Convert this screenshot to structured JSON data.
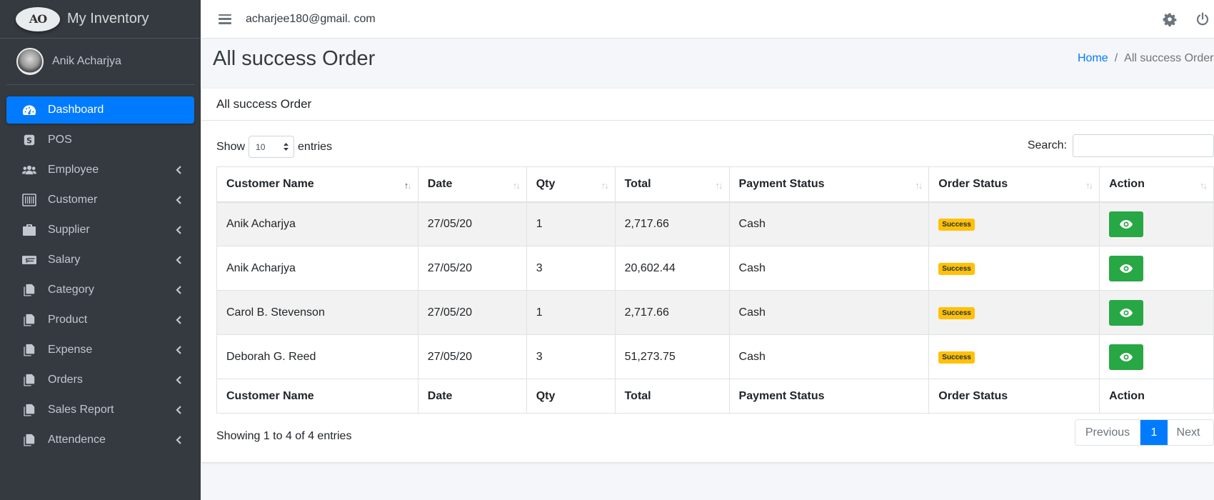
{
  "brand": {
    "logo_text": "AO",
    "name": "My Inventory"
  },
  "user": {
    "name": "Anik Acharjya"
  },
  "sidebar": {
    "items": [
      {
        "label": "Dashboard",
        "icon": "tachometer-icon",
        "active": true,
        "submenu": false
      },
      {
        "label": "POS",
        "icon": "pos-icon",
        "submenu": false
      },
      {
        "label": "Employee",
        "icon": "users-icon",
        "submenu": true
      },
      {
        "label": "Customer",
        "icon": "barcode-icon",
        "submenu": true
      },
      {
        "label": "Supplier",
        "icon": "briefcase-icon",
        "submenu": true
      },
      {
        "label": "Salary",
        "icon": "money-card-icon",
        "submenu": true
      },
      {
        "label": "Category",
        "icon": "copy-icon",
        "submenu": true
      },
      {
        "label": "Product",
        "icon": "copy-icon",
        "submenu": true
      },
      {
        "label": "Expense",
        "icon": "copy-icon",
        "submenu": true
      },
      {
        "label": "Orders",
        "icon": "copy-icon",
        "submenu": true
      },
      {
        "label": "Sales Report",
        "icon": "copy-icon",
        "submenu": true
      },
      {
        "label": "Attendence",
        "icon": "copy-icon",
        "submenu": true
      }
    ]
  },
  "topbar": {
    "email": "acharjee180@gmail. com",
    "icons": [
      "gear-icon",
      "power-icon"
    ]
  },
  "page": {
    "title": "All success Order",
    "breadcrumb": {
      "home": "Home",
      "separator": "/",
      "current": "All success Order"
    }
  },
  "card": {
    "title": "All success Order"
  },
  "table_controls": {
    "show_label": "Show",
    "page_length": "10",
    "entries_label": "entries",
    "search_label": "Search:",
    "search_value": ""
  },
  "table": {
    "columns": [
      "Customer Name",
      "Date",
      "Qty",
      "Total",
      "Payment Status",
      "Order Status",
      "Action"
    ],
    "rows": [
      {
        "customer": "Anik Acharjya",
        "date": "27/05/20",
        "qty": "1",
        "total": "2,717.66",
        "payment": "Cash",
        "status": "Success"
      },
      {
        "customer": "Anik Acharjya",
        "date": "27/05/20",
        "qty": "3",
        "total": "20,602.44",
        "payment": "Cash",
        "status": "Success"
      },
      {
        "customer": "Carol B. Stevenson",
        "date": "27/05/20",
        "qty": "1",
        "total": "2,717.66",
        "payment": "Cash",
        "status": "Success"
      },
      {
        "customer": "Deborah G. Reed",
        "date": "27/05/20",
        "qty": "3",
        "total": "51,273.75",
        "payment": "Cash",
        "status": "Success"
      }
    ],
    "sorted_column": "Customer Name"
  },
  "footer": {
    "info": "Showing 1 to 4 of 4 entries",
    "pagination": {
      "prev": "Previous",
      "current": "1",
      "next": "Next"
    }
  },
  "colors": {
    "sidebar_bg": "#343a40",
    "active": "#007bff",
    "success_button": "#28a745",
    "badge": "#ffc107"
  }
}
